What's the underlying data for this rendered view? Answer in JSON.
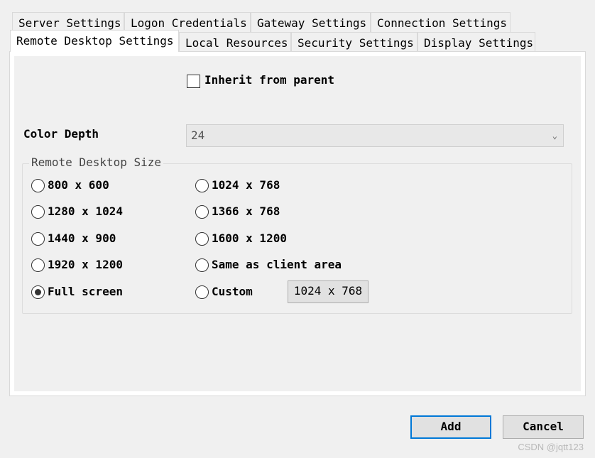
{
  "tabs": {
    "row1": [
      {
        "label": "Server Settings"
      },
      {
        "label": "Logon Credentials"
      },
      {
        "label": "Gateway Settings"
      },
      {
        "label": "Connection Settings"
      }
    ],
    "row2": [
      {
        "label": "Remote Desktop Settings",
        "active": true
      },
      {
        "label": "Local Resources"
      },
      {
        "label": "Security Settings"
      },
      {
        "label": "Display Settings"
      }
    ]
  },
  "inherit": {
    "label": "Inherit from parent",
    "checked": false
  },
  "color_depth": {
    "label": "Color Depth",
    "value": "24"
  },
  "size_group": {
    "title": "Remote Desktop Size",
    "options": [
      {
        "label": "800 x 600",
        "checked": false
      },
      {
        "label": "1024 x 768",
        "checked": false
      },
      {
        "label": "1280 x 1024",
        "checked": false
      },
      {
        "label": "1366 x 768",
        "checked": false
      },
      {
        "label": "1440 x 900",
        "checked": false
      },
      {
        "label": "1600 x 1200",
        "checked": false
      },
      {
        "label": "1920 x 1200",
        "checked": false
      },
      {
        "label": "Same as client area",
        "checked": false
      },
      {
        "label": "Full screen",
        "checked": true
      },
      {
        "label": "Custom",
        "checked": false
      }
    ],
    "custom_value": "1024 x 768"
  },
  "buttons": {
    "add": "Add",
    "cancel": "Cancel"
  },
  "watermark": "CSDN @jqtt123",
  "icons": {
    "combo_arrow": "chevron-down-icon"
  }
}
